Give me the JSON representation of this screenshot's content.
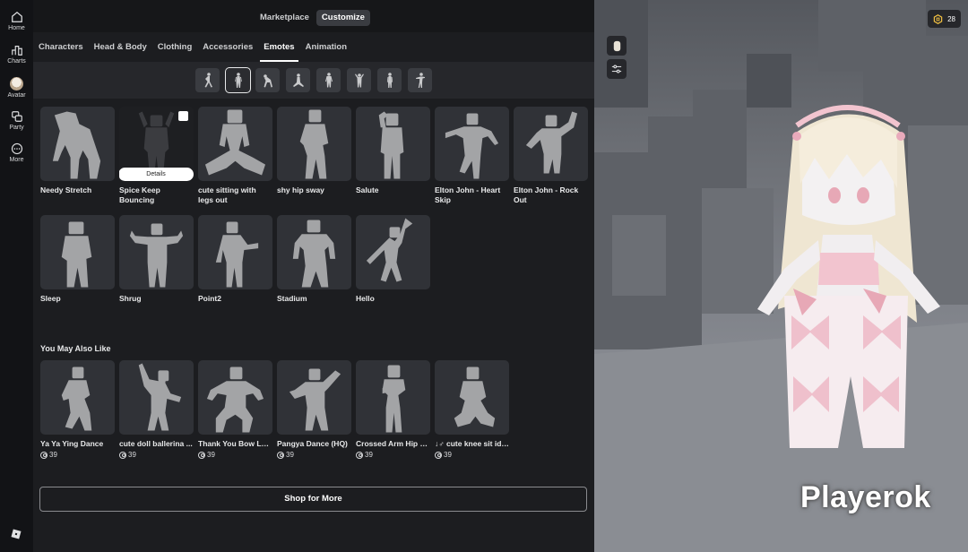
{
  "nav": {
    "items": [
      {
        "label": "Home",
        "icon": "home-icon"
      },
      {
        "label": "Charts",
        "icon": "charts-icon"
      },
      {
        "label": "Avatar",
        "icon": "avatar-icon"
      },
      {
        "label": "Party",
        "icon": "party-icon"
      },
      {
        "label": "More",
        "icon": "more-icon"
      }
    ]
  },
  "header": {
    "segments": [
      "Marketplace",
      "Customize"
    ],
    "active_segment": "Customize"
  },
  "tabs": {
    "items": [
      "Characters",
      "Head & Body",
      "Clothing",
      "Accessories",
      "Emotes",
      "Animation"
    ],
    "active": "Emotes"
  },
  "owned": [
    {
      "name": "Needy Stretch"
    },
    {
      "name": "Spice Keep Bouncing",
      "selected": true,
      "overlay": "Details"
    },
    {
      "name": "cute sitting with legs out"
    },
    {
      "name": "shy hip sway"
    },
    {
      "name": "Salute"
    },
    {
      "name": "Elton John - Heart Skip"
    },
    {
      "name": "Elton John - Rock Out"
    },
    {
      "name": "Sleep"
    },
    {
      "name": "Shrug"
    },
    {
      "name": "Point2"
    },
    {
      "name": "Stadium"
    },
    {
      "name": "Hello"
    }
  ],
  "recommended": {
    "title": "You May Also Like",
    "items": [
      {
        "name": "Ya Ya Ying Dance",
        "price": "39"
      },
      {
        "name": "cute doll ballerina ...",
        "price": "39"
      },
      {
        "name": "Thank You Bow Lad...",
        "price": "39"
      },
      {
        "name": "Pangya Dance (HQ)",
        "price": "39"
      },
      {
        "name": "Crossed Arm Hip S...",
        "price": "39"
      },
      {
        "name": "↓♂ cute knee sit idl...",
        "price": "39"
      }
    ]
  },
  "shop_button": "Shop for More",
  "viewport": {
    "robux_balance": "28",
    "watermark": "Playerok"
  },
  "colors": {
    "panel_bg": "#1c1d20",
    "card_bg": "#303237",
    "silhouette": "#a3a4a6",
    "accent_pink": "#f2b8c6"
  }
}
